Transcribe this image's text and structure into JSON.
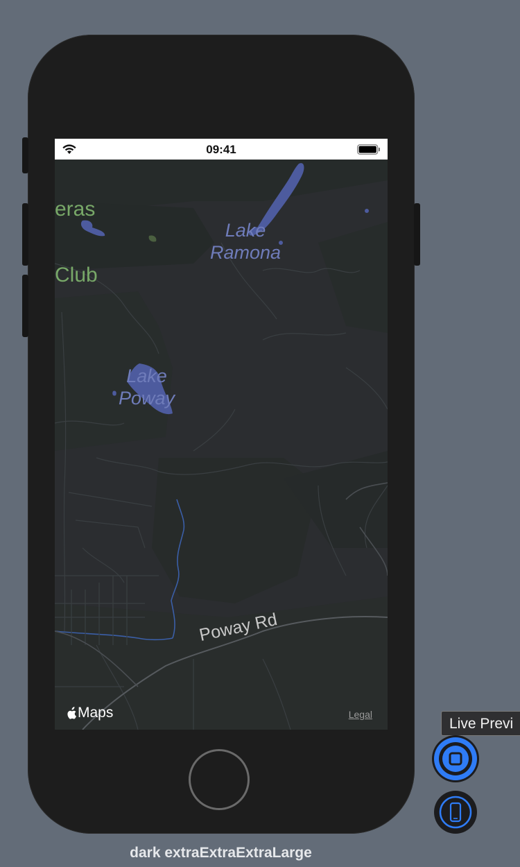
{
  "status_bar": {
    "time": "09:41"
  },
  "map": {
    "labels": {
      "club_line1": "eras",
      "club_line2": "Club",
      "lake_ramona": "Lake\nRamona",
      "lake_poway": "Lake\nPoway",
      "road": "Poway Rd"
    },
    "attribution": {
      "maps_label": "Maps",
      "legal_link": "Legal"
    }
  },
  "preview": {
    "caption": "dark extraExtraExtraLarge",
    "tooltip": "Live Previ"
  },
  "icons": [
    "wifi-icon",
    "battery-icon",
    "apple-logo-icon",
    "live-preview-icon",
    "device-preview-icon"
  ],
  "colors": {
    "background": "#636c78",
    "map_base": "#2b2d30",
    "water": "#4d5b9e",
    "water_label": "#6f7cba",
    "accent_blue": "#2f7cf6"
  }
}
